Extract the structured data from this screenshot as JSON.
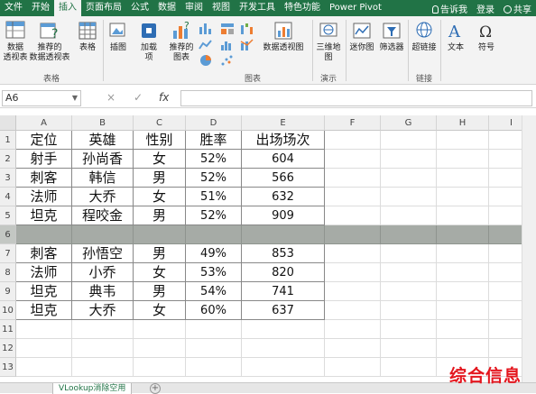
{
  "tabs": [
    "文件",
    "开始",
    "插入",
    "页面布局",
    "公式",
    "数据",
    "审阅",
    "视图",
    "开发工具",
    "特色功能",
    "Power Pivot"
  ],
  "active_tab": "插入",
  "tell_me": "告诉我",
  "login": "登录",
  "share": "共享",
  "ribbon": {
    "pivot_table": "数据\n透视表",
    "recommended_pivot": "推荐的\n数据透视表",
    "table": "表格",
    "group_tables": "表格",
    "illustrations": "插图",
    "addins": "加载\n项",
    "recommended_charts": "推荐的\n图表",
    "group_charts": "图表",
    "pivot_chart": "数据透视图",
    "map_3d": "三维地\n图",
    "group_tours": "演示",
    "sparklines": "迷你图",
    "slicer": "筛选器",
    "hyperlink": "超链接",
    "group_links": "链接",
    "text": "文本",
    "symbols": "符号"
  },
  "formula_bar": {
    "name_box": "A6",
    "cancel": "×",
    "enter": "✓",
    "fx": "fx",
    "value": ""
  },
  "columns": [
    "A",
    "B",
    "C",
    "D",
    "E",
    "F",
    "G",
    "H",
    "I"
  ],
  "rows": [
    {
      "n": "1",
      "cells": [
        "定位",
        "英雄",
        "性别",
        "胜率",
        "出场场次"
      ]
    },
    {
      "n": "2",
      "cells": [
        "射手",
        "孙尚香",
        "女",
        "52%",
        "604"
      ]
    },
    {
      "n": "3",
      "cells": [
        "刺客",
        "韩信",
        "男",
        "52%",
        "566"
      ]
    },
    {
      "n": "4",
      "cells": [
        "法师",
        "大乔",
        "女",
        "51%",
        "632"
      ]
    },
    {
      "n": "5",
      "cells": [
        "坦克",
        "程咬金",
        "男",
        "52%",
        "909"
      ]
    },
    {
      "n": "6",
      "cells": [
        "",
        "",
        "",
        "",
        ""
      ]
    },
    {
      "n": "7",
      "cells": [
        "刺客",
        "孙悟空",
        "男",
        "49%",
        "853"
      ]
    },
    {
      "n": "8",
      "cells": [
        "法师",
        "小乔",
        "女",
        "53%",
        "820"
      ]
    },
    {
      "n": "9",
      "cells": [
        "坦克",
        "典韦",
        "男",
        "54%",
        "741"
      ]
    },
    {
      "n": "10",
      "cells": [
        "坦克",
        "大乔",
        "女",
        "60%",
        "637"
      ]
    },
    {
      "n": "11",
      "cells": [
        "",
        "",
        "",
        "",
        ""
      ]
    },
    {
      "n": "12",
      "cells": [
        "",
        "",
        "",
        "",
        ""
      ]
    },
    {
      "n": "13",
      "cells": [
        "",
        "",
        "",
        "",
        ""
      ]
    }
  ],
  "sheet_tab": "VLookup消除空用",
  "watermark": "综合信息",
  "colors": {
    "excel_green": "#217346",
    "selected_row": "#a6aba6",
    "watermark": "#e4161e"
  }
}
